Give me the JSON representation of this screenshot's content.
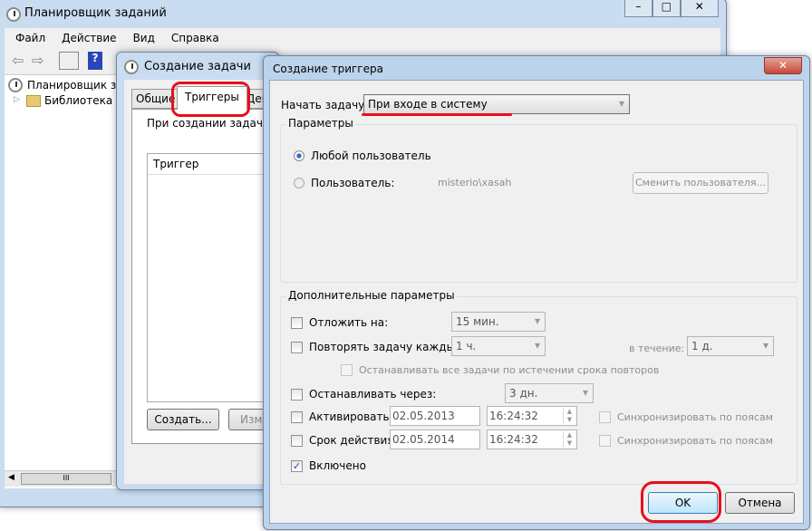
{
  "main": {
    "title": "Планировщик заданий",
    "menu": [
      "Файл",
      "Действие",
      "Вид",
      "Справка"
    ],
    "tree": [
      "Планировщик за",
      "Библиотека п"
    ]
  },
  "task_dialog": {
    "title": "Создание задачи",
    "tabs": [
      "Общие",
      "Триггеры",
      "Дей"
    ],
    "hint": "При создании задачи м",
    "column": "Триггер",
    "create": "Создать...",
    "edit": "Изме"
  },
  "trigger_dialog": {
    "title": "Создание триггера",
    "start_label": "Начать задачу:",
    "start_value": "При входе в систему",
    "params": {
      "legend": "Параметры",
      "any_user": "Любой пользователь",
      "user": "Пользователь:",
      "user_value": "misterio\\xasah",
      "change_user": "Сменить пользователя..."
    },
    "advanced": {
      "legend": "Дополнительные параметры",
      "delay": {
        "label": "Отложить на:",
        "value": "15 мин."
      },
      "repeat": {
        "label": "Повторять задачу каждые:",
        "value": "1 ч.",
        "duration_label": "в течение:",
        "duration": "1 д."
      },
      "stop_all": "Останавливать все задачи по истечении срока повторов",
      "stop_after": {
        "label": "Останавливать через:",
        "value": "3 дн."
      },
      "activate": {
        "label": "Активировать:",
        "date": "02.05.2013",
        "time": "16:24:32",
        "sync": "Синхронизировать по поясам"
      },
      "expire": {
        "label": "Срок действия:",
        "date": "02.05.2014",
        "time": "16:24:32",
        "sync": "Синхронизировать по поясам"
      },
      "enabled": "Включено"
    },
    "ok": "OK",
    "cancel": "Отмена"
  },
  "scroll": {
    "grip": "III"
  },
  "colors": {
    "highlight": "#e8101b",
    "close": "#c7483a"
  }
}
